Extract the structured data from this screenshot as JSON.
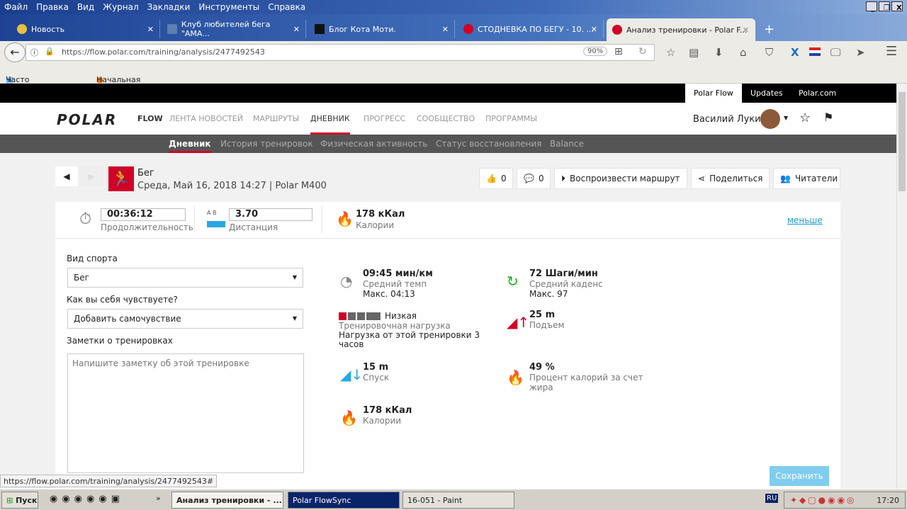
{
  "menu": [
    "Файл",
    "Правка",
    "Вид",
    "Журнал",
    "Закладки",
    "Инструменты",
    "Справка"
  ],
  "tabs": [
    {
      "title": "Новость"
    },
    {
      "title": "Клуб любителей бега \"АМА..."
    },
    {
      "title": "Блог Кота Моти."
    },
    {
      "title": "СТОДНЕВКА ПО БЕГУ - 10. ..."
    },
    {
      "title": "Анализ тренировки - Polar F..."
    }
  ],
  "url": "https://flow.polar.com/training/analysis/2477492543",
  "zoom": "90%",
  "bookmarks": [
    "Часто посещаемые",
    "Начальная страница"
  ],
  "polar_top": [
    "Polar Flow",
    "Updates",
    "Polar.com"
  ],
  "logo": "POLAR",
  "flow": "FLOW",
  "nav": [
    "ЛЕНТА НОВОСТЕЙ",
    "МАРШРУТЫ",
    "ДНЕВНИК",
    "ПРОГРЕСС",
    "СООБЩЕСТВО",
    "ПРОГРАММЫ"
  ],
  "user": "Василий Лукин",
  "subnav": [
    "Дневник",
    "История тренировок",
    "Физическая активность",
    "Статус восстановления",
    "Balance"
  ],
  "session": {
    "sport": "Бег",
    "subtitle": "Среда, Май 16, 2018 14:27 | Polar M400"
  },
  "actions": {
    "likes": "0",
    "comments": "0",
    "replay": "Воспроизвести маршрут",
    "share": "Поделиться",
    "readers": "Читатели"
  },
  "summary": {
    "duration": "00:36:12",
    "duration_label": "Продолжительность",
    "ab": "A  B",
    "distance": "3.70",
    "distance_label": "Дистанция",
    "calories": "178 кКал",
    "calories_label": "Калории",
    "less": "меньше"
  },
  "form": {
    "sport_label": "Вид спорта",
    "sport_value": "Бег",
    "feeling_label": "Как вы себя чувствуете?",
    "feeling_value": "Добавить самочувствие",
    "notes_label": "Заметки о тренировках",
    "notes_placeholder": "Напишите заметку об этой тренировке",
    "save": "Сохранить"
  },
  "metrics": {
    "pace": {
      "value": "09:45 мин/км",
      "label": "Средний темп",
      "max": "Макс. 04:13"
    },
    "cadence": {
      "value": "72 Шаги/мин",
      "label": "Средний каденс",
      "max": "Макс. 97"
    },
    "load": {
      "level": "Низкая",
      "label": "Тренировочная нагрузка",
      "desc": "Нагрузка от этой тренировки 3 часов",
      "filled": 1,
      "total": 4
    },
    "ascent": {
      "value": "25 m",
      "label": "Подъем"
    },
    "descent": {
      "value": "15 m",
      "label": "Спуск"
    },
    "fat": {
      "value": "49 %",
      "label": "Процент калорий за счет жира"
    },
    "calories": {
      "value": "178 кКал",
      "label": "Калории"
    }
  },
  "status_url": "https://flow.polar.com/training/analysis/2477492543#",
  "taskbar": {
    "start": "Пуск",
    "tasks": [
      "Анализ тренировки - ...",
      "Polar FlowSync",
      "16-051 - Paint"
    ],
    "lang": "RU",
    "time": "17:20"
  },
  "colors": {
    "accent": "#d10027",
    "link": "#1a9ad6",
    "save": "#7fcdf0"
  }
}
